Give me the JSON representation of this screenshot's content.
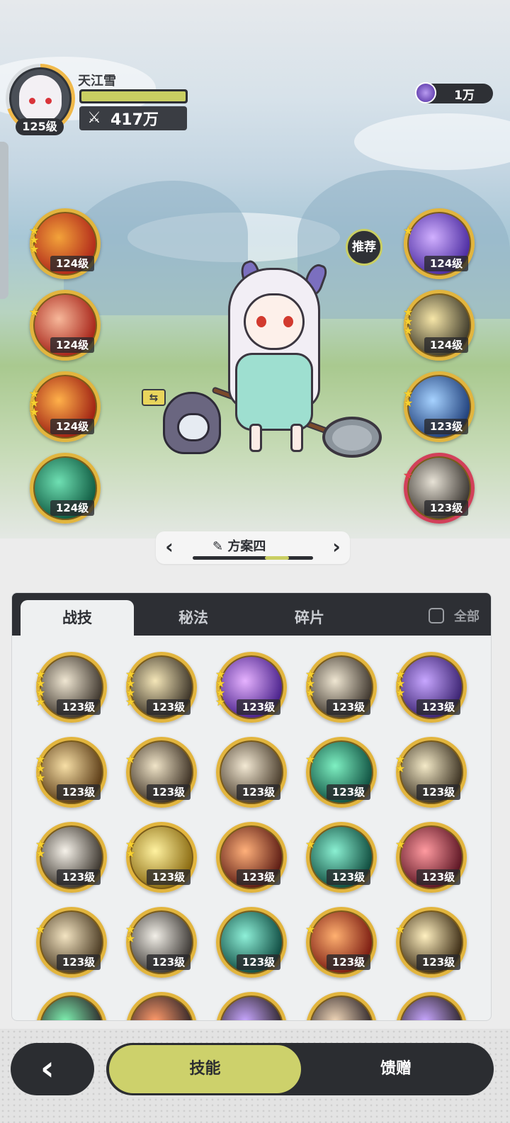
{
  "player": {
    "name": "天江雪",
    "level": "125级",
    "power": "417万",
    "hp_fraction": 1.0
  },
  "currency": {
    "amount": "1万",
    "icon": "purple-gem-icon"
  },
  "recommend_label": "推荐",
  "equipped_left": [
    {
      "level": "124级",
      "stars": 3,
      "colors": [
        "#f3a33a",
        "#b0271a"
      ]
    },
    {
      "level": "124级",
      "stars": 1,
      "colors": [
        "#f7b89a",
        "#a62217"
      ]
    },
    {
      "level": "124级",
      "stars": 3,
      "colors": [
        "#ffb14a",
        "#9e1f12"
      ]
    },
    {
      "level": "124级",
      "stars": 0,
      "colors": [
        "#6fe0b3",
        "#0f5a41"
      ]
    }
  ],
  "equipped_right": [
    {
      "level": "124级",
      "stars": 1,
      "colors": [
        "#d1b0ff",
        "#4a2aa0"
      ]
    },
    {
      "level": "124级",
      "stars": 3,
      "colors": [
        "#f6e6a8",
        "#3e3a2a"
      ]
    },
    {
      "level": "123级",
      "stars": 2,
      "colors": [
        "#a6d2ff",
        "#1f3f7a"
      ]
    },
    {
      "level": "123级",
      "stars": 1,
      "colors": [
        "#e7e2d6",
        "#3a3530"
      ],
      "red": true
    }
  ],
  "preset": {
    "label": "方案四",
    "position_fraction": 0.75
  },
  "tabs": [
    {
      "label": "战技",
      "active": true
    },
    {
      "label": "秘法",
      "active": false
    },
    {
      "label": "碎片",
      "active": false
    }
  ],
  "all_toggle_label": "全部",
  "skill_grid": [
    {
      "level": "123级",
      "stars": 4,
      "colors": [
        "#efe6d2",
        "#3d352c"
      ]
    },
    {
      "level": "123级",
      "stars": 4,
      "colors": [
        "#f4e6b8",
        "#3a3226"
      ]
    },
    {
      "level": "123级",
      "stars": 4,
      "colors": [
        "#e6b2ff",
        "#48208a"
      ]
    },
    {
      "level": "123级",
      "stars": 3,
      "colors": [
        "#efe6d2",
        "#3d352c"
      ]
    },
    {
      "level": "123级",
      "stars": 3,
      "colors": [
        "#c7a6ff",
        "#3a2270"
      ]
    },
    {
      "level": "123级",
      "stars": 3,
      "colors": [
        "#f7dfa6",
        "#5a3a14"
      ]
    },
    {
      "level": "123级",
      "stars": 1,
      "colors": [
        "#f0e4c8",
        "#3b2f22"
      ]
    },
    {
      "level": "123级",
      "stars": 0,
      "colors": [
        "#f3e9d4",
        "#4a3d2c"
      ]
    },
    {
      "level": "123级",
      "stars": 1,
      "colors": [
        "#7ef0c2",
        "#0f5040"
      ]
    },
    {
      "level": "123级",
      "stars": 2,
      "colors": [
        "#f4eac8",
        "#3a3020"
      ]
    },
    {
      "level": "123级",
      "stars": 2,
      "colors": [
        "#f6f2ea",
        "#3a342c"
      ]
    },
    {
      "level": "123级",
      "stars": 2,
      "colors": [
        "#fff2a0",
        "#8a6a10"
      ]
    },
    {
      "level": "123级",
      "stars": 0,
      "colors": [
        "#ffb07a",
        "#5a1a12"
      ]
    },
    {
      "level": "123级",
      "stars": 1,
      "colors": [
        "#8af0d2",
        "#0e4a3c"
      ]
    },
    {
      "level": "123级",
      "stars": 1,
      "colors": [
        "#ff9aa0",
        "#5a1422"
      ]
    },
    {
      "level": "123级",
      "stars": 1,
      "colors": [
        "#f3e4c2",
        "#4a3a22"
      ]
    },
    {
      "level": "123级",
      "stars": 2,
      "colors": [
        "#f2efe8",
        "#3a3632"
      ]
    },
    {
      "level": "123级",
      "stars": 0,
      "colors": [
        "#8ef0d8",
        "#0e4a40"
      ]
    },
    {
      "level": "123级",
      "stars": 1,
      "colors": [
        "#ffb070",
        "#7a1a10"
      ]
    },
    {
      "level": "123级",
      "stars": 1,
      "colors": [
        "#fff0c0",
        "#3a2a12"
      ]
    }
  ],
  "skill_grid_partial_colors": [
    "#7ef0b0",
    "#ff9a6a",
    "#c7a6ff",
    "#f0d6b8",
    "#c7a6ff"
  ],
  "bottom_nav": {
    "active_label": "技能",
    "inactive_label": "馈赠"
  }
}
